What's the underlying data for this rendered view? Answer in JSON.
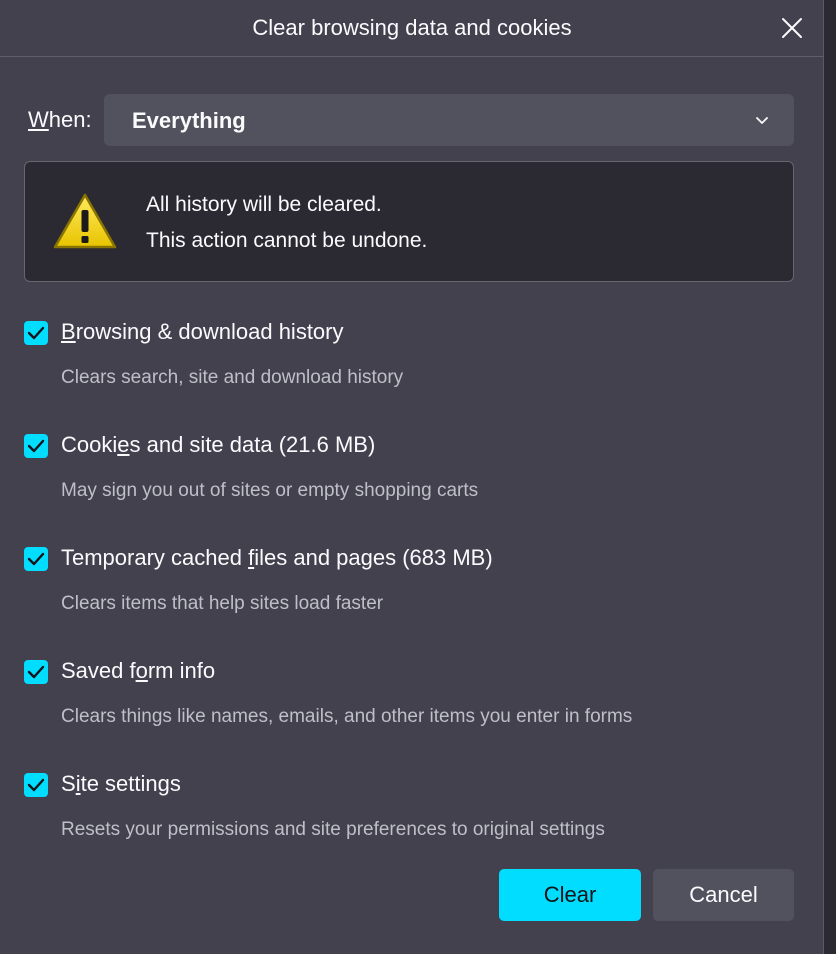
{
  "dialog": {
    "title": "Clear browsing data and cookies",
    "close_icon": "close-icon"
  },
  "when": {
    "label_prefix": "W",
    "label_rest": "hen:",
    "selected": "Everything"
  },
  "warning": {
    "icon": "warning-triangle-icon",
    "line1": "All history will be cleared.",
    "line2": "This action cannot be undone."
  },
  "options": [
    {
      "label_before": "",
      "label_access": "B",
      "label_after": "rowsing & download history",
      "description": "Clears search, site and download history",
      "checked": true
    },
    {
      "label_before": "Cooki",
      "label_access": "e",
      "label_after": "s and site data (21.6 MB)",
      "description": "May sign you out of sites or empty shopping carts",
      "checked": true
    },
    {
      "label_before": "Temporary cached ",
      "label_access": "f",
      "label_after": "iles and pages (683 MB)",
      "description": "Clears items that help sites load faster",
      "checked": true
    },
    {
      "label_before": "Saved f",
      "label_access": "o",
      "label_after": "rm info",
      "description": "Clears things like names, emails, and other items you enter in forms",
      "checked": true
    },
    {
      "label_before": "S",
      "label_access": "i",
      "label_after": "te settings",
      "description": "Resets your permissions and site preferences to original settings",
      "checked": true
    }
  ],
  "buttons": {
    "clear": "Clear",
    "cancel": "Cancel"
  },
  "colors": {
    "accent": "#00ddff",
    "dialog_bg": "#42414d",
    "warning_bg": "#2b2a33"
  }
}
